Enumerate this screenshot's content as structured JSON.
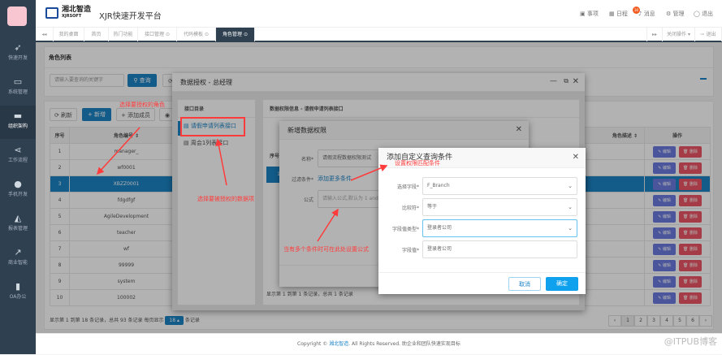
{
  "app": {
    "logo_cn": "湘北智造",
    "logo_en": "XJRSOFT",
    "title": "XJR快速开发平台"
  },
  "header_nav": [
    {
      "icon": "calendar-check-icon",
      "label": "事项",
      "badge": "30"
    },
    {
      "icon": "calendar-icon",
      "label": "日程"
    },
    {
      "icon": "bell-icon",
      "label": "消息"
    },
    {
      "icon": "gear-icon",
      "label": "管理"
    },
    {
      "icon": "user-icon",
      "label": "退出"
    }
  ],
  "sidebar": [
    {
      "icon": "paper-plane-icon",
      "label": "快速开发"
    },
    {
      "icon": "monitor-icon",
      "label": "系统管理"
    },
    {
      "icon": "org-icon",
      "label": "组织架构",
      "active": true
    },
    {
      "icon": "share-icon",
      "label": "工作流程"
    },
    {
      "icon": "android-icon",
      "label": "手机开发"
    },
    {
      "icon": "area-chart-icon",
      "label": "报表管理"
    },
    {
      "icon": "line-chart-icon",
      "label": "商业智能"
    },
    {
      "icon": "bookmark-icon",
      "label": "OA办公"
    }
  ],
  "tabs": [
    {
      "label": "我的桌面"
    },
    {
      "label": "首页"
    },
    {
      "label": "热门功能"
    },
    {
      "label": "接口管理 ⊙"
    },
    {
      "label": "代码模板 ⊙"
    },
    {
      "label": "角色管理 ⊙",
      "active": true
    }
  ],
  "tabbar_right": {
    "close_ops": "关闭操作 ▾",
    "logout": "⇨ 退出"
  },
  "role_list": {
    "title": "角色列表",
    "search_placeholder": "请输入要查询的关键字",
    "search_btn": "查询"
  },
  "toolbar": {
    "refresh": "刷新",
    "add": "新增",
    "add_member": "添加成员"
  },
  "table": {
    "headers": [
      "序号",
      "角色编号 ⇕",
      "角色描述 ⇕",
      "操作"
    ],
    "rows": [
      [
        "1",
        "manager_"
      ],
      [
        "2",
        "wf0001"
      ],
      [
        "3",
        "XBZZ0001"
      ],
      [
        "4",
        "fdgdfgf"
      ],
      [
        "5",
        "AgileDevelopment"
      ],
      [
        "6",
        "teacher"
      ],
      [
        "7",
        "wf"
      ],
      [
        "8",
        "99999"
      ],
      [
        "9",
        "system"
      ],
      [
        "10",
        "100002"
      ]
    ],
    "selected_row": 3,
    "edit": "编辑",
    "delete": "删除"
  },
  "pagination": {
    "summary": "显示第 1 到第 18 条记录，总共 93 条记录 每页显示",
    "page_size": "18 ▴",
    "suffix": "条记录",
    "pages": [
      "‹",
      "1",
      "2",
      "3",
      "4",
      "5",
      "6",
      "›"
    ],
    "current": "1"
  },
  "modal_auth": {
    "title": "数据授权 - 总经理",
    "left_title": "接口目录",
    "items": [
      "请假申请列表接口",
      "周会1列表接口"
    ],
    "right_title": "数据权限信息 - 请假申请列表接口",
    "right_summary": "显示第 1 到第 1 条记录，总共 1 条记录",
    "row_no": "1",
    "col_no": "序号"
  },
  "modal_add": {
    "title": "新增数据权限",
    "name_label": "名称*",
    "name_value": "请假流程数据权限测试",
    "filter_label": "过滤条件*",
    "filter_link": "添加更多条件",
    "formula_label": "公式",
    "formula_placeholder": "请输入公式,默认为 1 and 2"
  },
  "modal_cond": {
    "title": "添加自定义查询条件",
    "fields": [
      {
        "label": "选择字段*",
        "value": "F_Branch",
        "select": true
      },
      {
        "label": "比较符*",
        "value": "等于",
        "select": true
      },
      {
        "label": "字段值类型*",
        "value": "登录者公司",
        "select": true,
        "focused": true
      },
      {
        "label": "字段值*",
        "value": "登录者公司",
        "select": false
      }
    ],
    "cancel": "取消",
    "ok": "确定"
  },
  "annotations": [
    "选择要授权的角色",
    "选择要被授权的数据项",
    "当有多个条件时可在此处设置公式",
    "设置权限匹配条件"
  ],
  "footer": {
    "prefix": "Copyright © ",
    "link": "湘北智造",
    "suffix": ". All Rights Reserved. 助企业和团队快速实现目标"
  },
  "watermark": "@ITPUB博客",
  "colors": {
    "sidebar": "#2f4050",
    "primary": "#1c84c6",
    "annotation": "#ff3b3b",
    "edit": "#6c7ae0",
    "delete": "#ed5565",
    "confirm": "#0fa0ee"
  }
}
